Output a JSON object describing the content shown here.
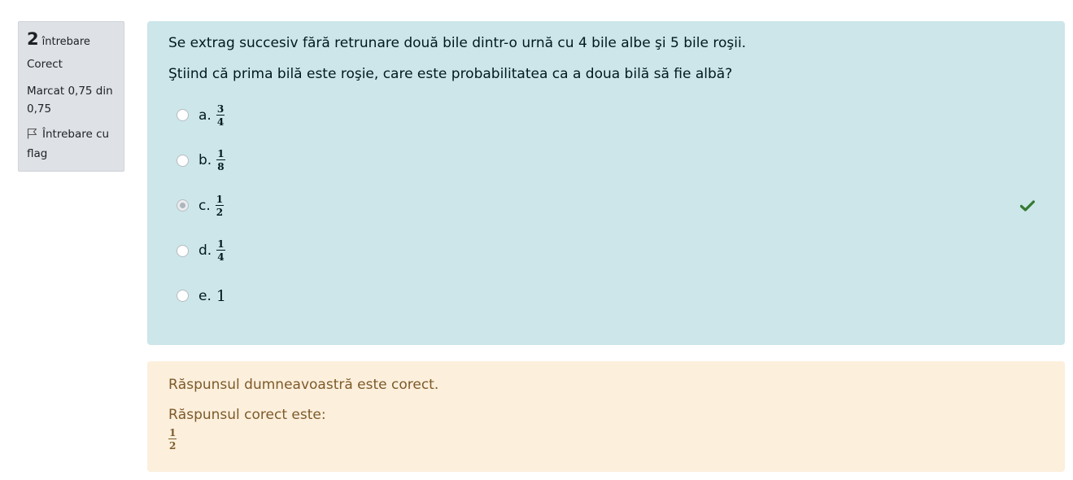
{
  "info": {
    "number": "2",
    "label": "întrebare",
    "state": "Corect",
    "grade": "Marcat 0,75 din 0,75",
    "flag_label": "Întrebare cu flag",
    "flag_icon": "flag-icon"
  },
  "question": {
    "text1": "Se extrag succesiv fără retrunare două bile dintr-o urnă cu 4 bile albe şi 5 bile roşii.",
    "text2": "Ştiind că prima bilă este roşie, care este probabilitatea ca a doua bilă să fie albă?",
    "answers": [
      {
        "letter": "a.",
        "num": "3",
        "den": "4",
        "selected": false
      },
      {
        "letter": "b.",
        "num": "1",
        "den": "8",
        "selected": false
      },
      {
        "letter": "c.",
        "num": "1",
        "den": "2",
        "selected": true,
        "correct_icon": "check-icon"
      },
      {
        "letter": "d.",
        "num": "1",
        "den": "4",
        "selected": false
      },
      {
        "letter": "e.",
        "value": "1",
        "selected": false
      }
    ]
  },
  "feedback": {
    "specific": "Răspunsul dumneavoastră este corect.",
    "right_answer_label": "Răspunsul corect este:",
    "right_answer_num": "1",
    "right_answer_den": "2"
  },
  "colors": {
    "formulation_bg": "#cce6ea",
    "feedback_bg": "#fcefdc",
    "info_bg": "#dee2e6",
    "correct": "#357a32"
  }
}
